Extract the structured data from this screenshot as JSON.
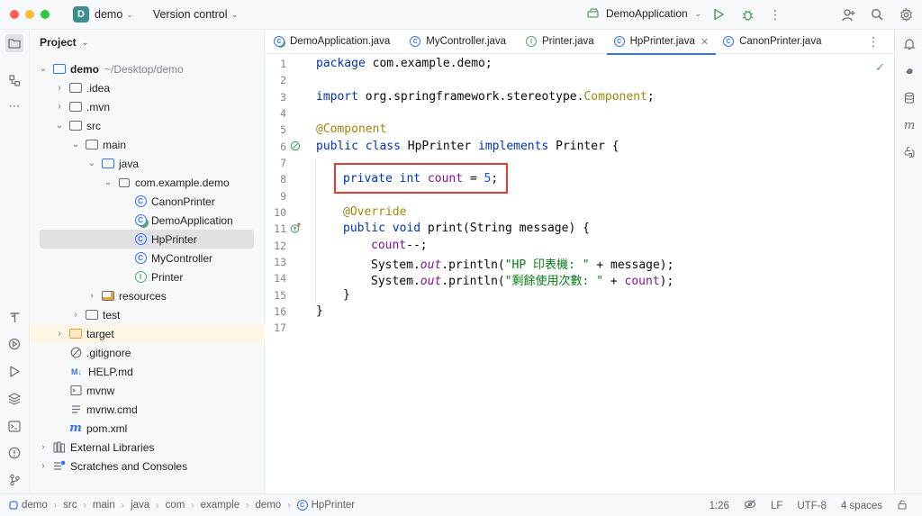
{
  "titlebar": {
    "project_initial": "D",
    "project_name": "demo",
    "vcs_label": "Version control",
    "run_config": "DemoApplication"
  },
  "project_panel": {
    "title": "Project",
    "tree": [
      {
        "label": "demo",
        "extra": "~/Desktop/demo",
        "icon": "module-folder-icon",
        "arrow": "down"
      },
      {
        "label": ".idea",
        "icon": "folder-icon",
        "arrow": "right"
      },
      {
        "label": ".mvn",
        "icon": "folder-icon",
        "arrow": "right"
      },
      {
        "label": "src",
        "icon": "folder-icon",
        "arrow": "down"
      },
      {
        "label": "main",
        "icon": "folder-icon",
        "arrow": "down"
      },
      {
        "label": "java",
        "icon": "source-folder-icon",
        "arrow": "down"
      },
      {
        "label": "com.example.demo",
        "icon": "package-icon",
        "arrow": "down"
      },
      {
        "label": "CanonPrinter",
        "icon": "class-icon"
      },
      {
        "label": "DemoApplication",
        "icon": "spring-class-icon"
      },
      {
        "label": "HpPrinter",
        "icon": "class-icon"
      },
      {
        "label": "MyController",
        "icon": "class-icon"
      },
      {
        "label": "Printer",
        "icon": "interface-icon"
      },
      {
        "label": "resources",
        "icon": "resources-folder-icon",
        "arrow": "right"
      },
      {
        "label": "test",
        "icon": "folder-icon",
        "arrow": "right"
      },
      {
        "label": "target",
        "icon": "excluded-folder-icon",
        "arrow": "right"
      },
      {
        "label": ".gitignore",
        "icon": "gitignore-icon"
      },
      {
        "label": "HELP.md",
        "icon": "markdown-icon"
      },
      {
        "label": "mvnw",
        "icon": "script-icon"
      },
      {
        "label": "mvnw.cmd",
        "icon": "text-file-icon"
      },
      {
        "label": "pom.xml",
        "icon": "maven-icon"
      },
      {
        "label": "External Libraries",
        "icon": "libraries-icon",
        "arrow": "right"
      },
      {
        "label": "Scratches and Consoles",
        "icon": "scratches-icon",
        "arrow": "right"
      }
    ]
  },
  "tabs": [
    {
      "label": "DemoApplication.java",
      "icon": "spring-class-icon"
    },
    {
      "label": "MyController.java",
      "icon": "class-icon"
    },
    {
      "label": "Printer.java",
      "icon": "interface-icon"
    },
    {
      "label": "HpPrinter.java",
      "icon": "class-icon",
      "active": true
    },
    {
      "label": "CanonPrinter.java",
      "icon": "class-icon"
    }
  ],
  "editor": {
    "line_numbers": [
      "1",
      "2",
      "3",
      "4",
      "5",
      "6",
      "7",
      "8",
      "9",
      "10",
      "11",
      "12",
      "13",
      "14",
      "15",
      "16",
      "17"
    ],
    "lines": {
      "l1": {
        "kw": "package",
        "rest": " com.example.demo;"
      },
      "l3": {
        "kw": "import",
        "rest": " org.springframework.stereotype.",
        "ann": "Component",
        "end": ";"
      },
      "l5": {
        "ann": "@Component"
      },
      "l6": {
        "kw1": "public class",
        "name": " HpPrinter ",
        "kw2": "implements",
        "rest": " Printer {"
      },
      "l8": {
        "kw": "private int",
        "field": "count",
        "op": " = ",
        "num": "5",
        "end": ";"
      },
      "l10": {
        "ann": "@Override"
      },
      "l11": {
        "kw": "public void",
        "rest": " print(String message) {"
      },
      "l12": {
        "field": "count",
        "rest": "--;"
      },
      "l13": {
        "obj": "System.",
        "stat": "out",
        "call": ".println(",
        "str": "\"HP 印表機: \"",
        "rest": " + message);"
      },
      "l14": {
        "obj": "System.",
        "stat": "out",
        "call": ".println(",
        "str": "\"剩餘使用次數: \"",
        "mid": " + ",
        "field": "count",
        "end": ");"
      },
      "l15": {
        "rest": "}"
      },
      "l16": {
        "rest": "}"
      }
    }
  },
  "statusbar": {
    "breadcrumbs": [
      "demo",
      "src",
      "main",
      "java",
      "com",
      "example",
      "demo",
      "HpPrinter"
    ],
    "position": "1:26",
    "line_ending": "LF",
    "encoding": "UTF-8",
    "indent": "4 spaces"
  }
}
